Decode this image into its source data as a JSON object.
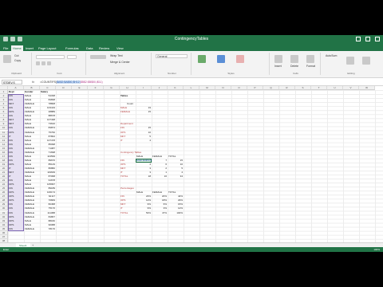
{
  "window": {
    "title": "ContingencyTables"
  },
  "tabs": [
    "File",
    "Home",
    "Insert",
    "Page Layout",
    "Formulas",
    "Data",
    "Review",
    "View"
  ],
  "active_tab": "Home",
  "ribbon": {
    "clipboard": {
      "label": "Clipboard",
      "cut": "Cut",
      "copy": "Copy"
    },
    "font": {
      "label": "Font"
    },
    "alignment": {
      "label": "Alignment",
      "wrap": "Wrap Text",
      "merge": "Merge & Center"
    },
    "number": {
      "label": "Number",
      "format": "General"
    },
    "styles": {
      "label": "Styles"
    },
    "cells": {
      "label": "Cells",
      "insert": "Insert",
      "delete": "Delete",
      "format": "Format"
    },
    "editing": {
      "label": "Editing",
      "autosum": "AutoSum",
      "sort": "Sort & Filter",
      "find": "Find & Select"
    }
  },
  "formula_bar": {
    "name_box": "STDEV.S",
    "fx": "fx",
    "formula_pre": "=COUNTIFS(",
    "formula_range": "$A$2:$A$50,$H12,",
    "formula_post": "$B$2:$B$50,I$11)"
  },
  "columns": [
    "A",
    "B",
    "C",
    "D",
    "E",
    "F",
    "G",
    "H",
    "I",
    "J",
    "K",
    "L",
    "M",
    "N",
    "O",
    "P",
    "Q",
    "R",
    "S",
    "T",
    "U",
    "V",
    "W"
  ],
  "rows": [
    "1",
    "2",
    "3",
    "4",
    "5",
    "6",
    "7",
    "8",
    "9",
    "10",
    "11",
    "12",
    "13",
    "14",
    "15",
    "16",
    "17",
    "18",
    "19",
    "20",
    "21",
    "22",
    "23",
    "24",
    "25",
    "26",
    "27",
    "28",
    "29",
    "30",
    "31",
    "32",
    "33",
    "34",
    "35",
    "36",
    "37",
    "38"
  ],
  "headers": {
    "a": "Dept",
    "b": "Gender",
    "c": "Salary"
  },
  "data_rows": [
    [
      "FIN",
      "MALE",
      "54338"
    ],
    [
      "FIN",
      "MALE",
      "84838"
    ],
    [
      "MKT",
      "FEMALE",
      "78808"
    ],
    [
      "FIN",
      "MALE",
      "103419"
    ],
    [
      "OPS",
      "FEMALE",
      "48889"
    ],
    [
      "FIN",
      "MALE",
      "88678"
    ],
    [
      "MKT",
      "MALE",
      "107438"
    ],
    [
      "MKT",
      "MALE",
      "73610"
    ],
    [
      "FIN",
      "FEMALE",
      "83874"
    ],
    [
      "OPS",
      "FEMALE",
      "75760"
    ],
    [
      "IT",
      "MALE",
      "87802"
    ],
    [
      "FIN",
      "MALE",
      "107478"
    ],
    [
      "FIN",
      "MALE",
      "85098"
    ],
    [
      "FIN",
      "FEMALE",
      "71087"
    ],
    [
      "FIN",
      "FEMALE",
      "71698"
    ],
    [
      "FIN",
      "MALE",
      "113599"
    ],
    [
      "FIN",
      "MALE",
      "89670"
    ],
    [
      "OPS",
      "MALE",
      "85149"
    ],
    [
      "IT",
      "FEMALE",
      "86882"
    ],
    [
      "MKT",
      "FEMALE",
      "119639"
    ],
    [
      "IT",
      "MALE",
      "87068"
    ],
    [
      "FIN",
      "MALE",
      "91678"
    ],
    [
      "OPS",
      "MALE",
      "105997"
    ],
    [
      "FIN",
      "FEMALE",
      "89189"
    ],
    [
      "OPS",
      "FEMALE",
      "106174"
    ],
    [
      "OPS",
      "FEMALE",
      "62117"
    ],
    [
      "OPS",
      "FEMALE",
      "70849"
    ],
    [
      "FIN",
      "FEMALE",
      "82468"
    ],
    [
      "FIN",
      "FEMALE",
      "75170"
    ],
    [
      "FIN",
      "FEMALE",
      "111088"
    ],
    [
      "OPS",
      "FEMALE",
      "84867"
    ],
    [
      "OPS",
      "MALE",
      "88182"
    ],
    [
      "OPS",
      "MALE",
      "90088"
    ],
    [
      "FIN",
      "FEMALE",
      "78170"
    ]
  ],
  "summary": {
    "title": "Tables",
    "count_label": "Count",
    "gender": [
      [
        "MALE",
        "19"
      ],
      [
        "FEMALE",
        "15"
      ]
    ],
    "dept_label": "Department",
    "dept": [
      [
        "FIN",
        "15"
      ],
      [
        "OPS",
        "10"
      ],
      [
        "MKT",
        "5"
      ],
      [
        "IT",
        "4"
      ]
    ],
    "contingency_label": "Contingency Tables",
    "ct_headers": [
      "MALE",
      "FEMALE",
      "TOTAL"
    ],
    "ct_rows": [
      [
        "FIN",
        "8",
        "7",
        "15"
      ],
      [
        "OPS",
        "4",
        "6",
        "10"
      ],
      [
        "MKT",
        "3",
        "2",
        "5"
      ],
      [
        "IT",
        "3",
        "1",
        "4"
      ],
      [
        "TOTAL",
        "18",
        "16",
        "34"
      ]
    ],
    "ct_active_value": "$A$2:$A$50,$H",
    "pct_label": "Percentages",
    "pct_headers": [
      "MALE",
      "FEMALE",
      "TOTAL"
    ],
    "pct_rows": [
      [
        "FIN",
        "23%",
        "20%",
        "44%"
      ],
      [
        "OPS",
        "12%",
        "18%",
        "29%"
      ],
      [
        "MKT",
        "9%",
        "6%",
        "15%"
      ],
      [
        "IT",
        "9%",
        "3%",
        "12%"
      ],
      [
        "TOTAL",
        "53%",
        "47%",
        "100%"
      ]
    ]
  },
  "sheet": {
    "name": "Sheet1",
    "add": "+"
  },
  "status": {
    "left": "Enter",
    "zoom": "100%"
  },
  "colors": {
    "excel_green": "#217346",
    "selection_purple": "#7b64b0",
    "red_label": "#b23b3b"
  }
}
